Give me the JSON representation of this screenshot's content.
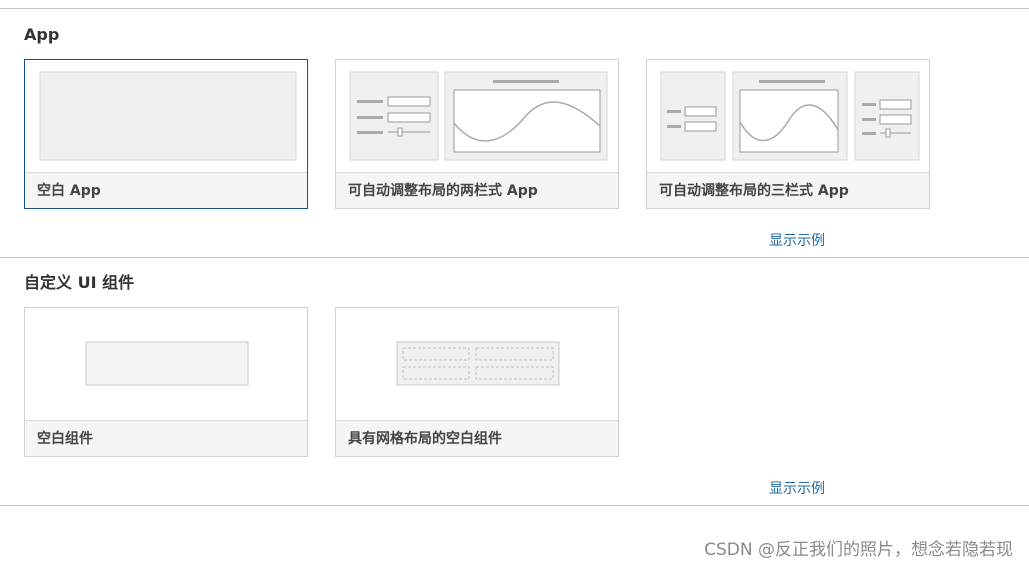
{
  "sections": [
    {
      "title": "App",
      "cards": [
        {
          "caption": "空白 App"
        },
        {
          "caption": "可自动调整布局的两栏式 App"
        },
        {
          "caption": "可自动调整布局的三栏式 App"
        }
      ],
      "show_example": "显示示例"
    },
    {
      "title": "自定义 UI 组件",
      "cards": [
        {
          "caption": "空白组件"
        },
        {
          "caption": "具有网格布局的空白组件"
        }
      ],
      "show_example": "显示示例"
    }
  ],
  "watermark": "CSDN @反正我们的照片，想念若隐若现",
  "colors": {
    "selected_border": "#1b4f8c",
    "link": "#1f6aa6"
  }
}
